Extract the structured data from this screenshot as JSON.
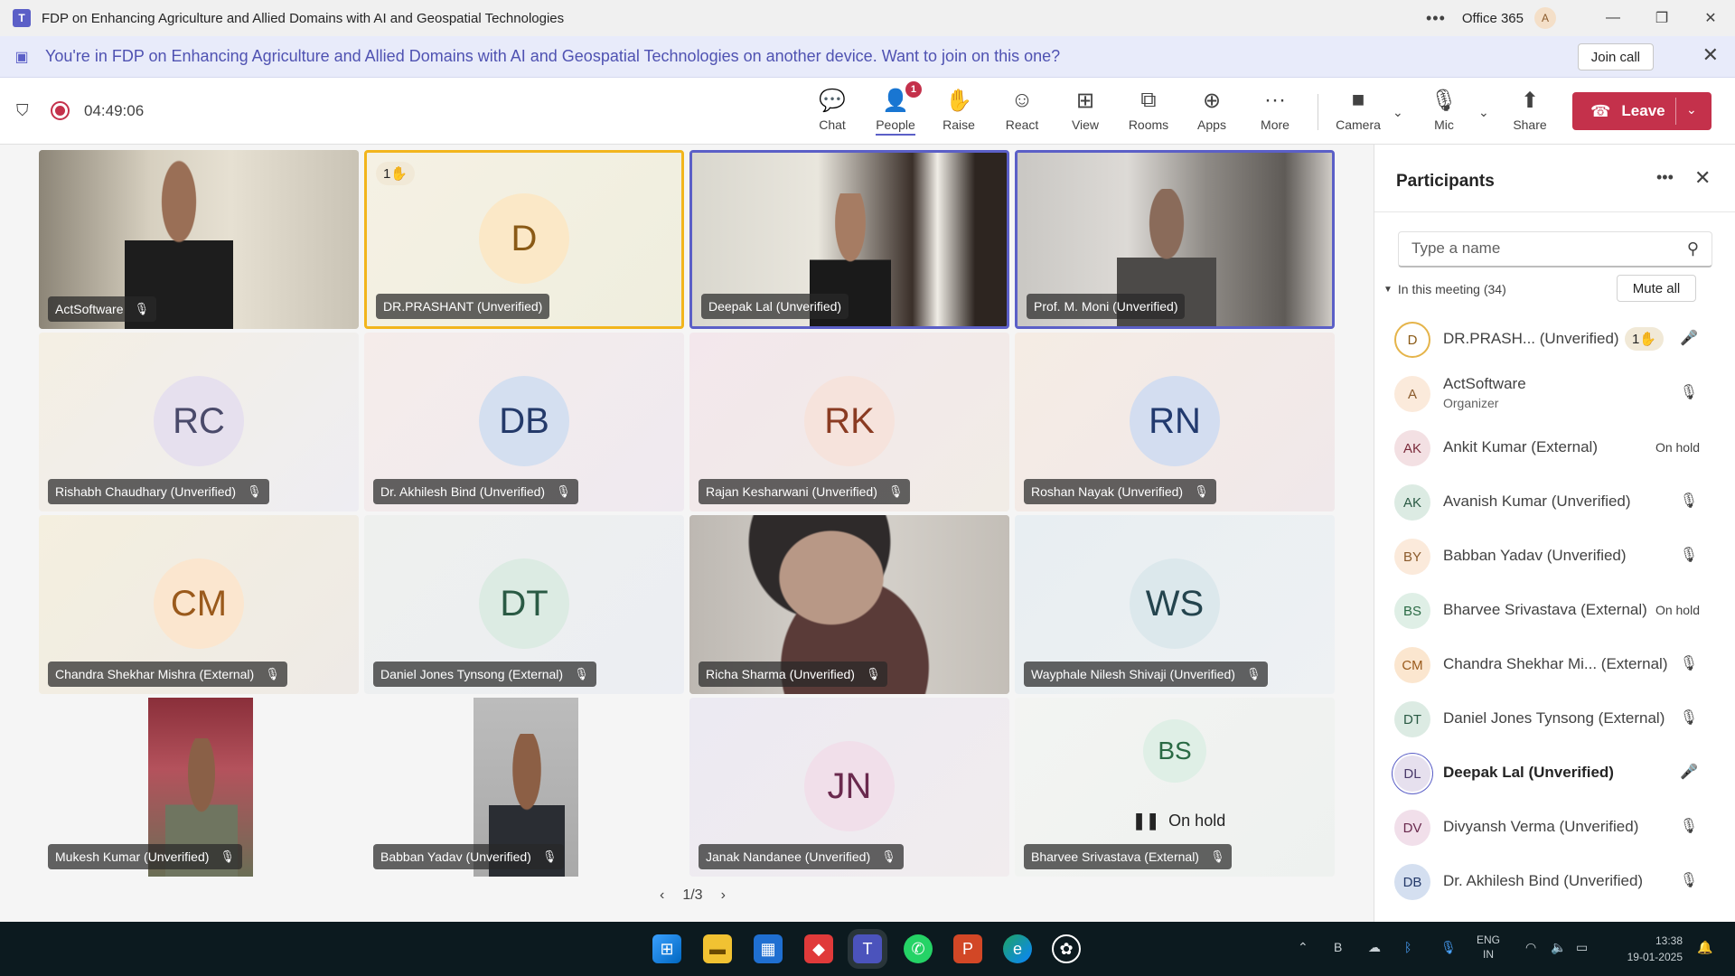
{
  "window": {
    "title": "FDP on Enhancing Agriculture and Allied Domains with AI and Geospatial Technologies",
    "account_label": "Office 365",
    "account_initial": "A"
  },
  "banner": {
    "text": "You're in FDP on Enhancing Agriculture and Allied Domains with AI and Geospatial Technologies on another device. Want to join on this one?",
    "join_label": "Join call"
  },
  "toolbar": {
    "timer": "04:49:06",
    "buttons": {
      "chat": "Chat",
      "people": "People",
      "people_badge": "1",
      "raise": "Raise",
      "react": "React",
      "view": "View",
      "rooms": "Rooms",
      "apps": "Apps",
      "more": "More",
      "camera": "Camera",
      "mic": "Mic",
      "share": "Share",
      "leave": "Leave"
    }
  },
  "tiles": [
    {
      "name": "ActSoftware",
      "type": "video"
    },
    {
      "name": "DR.PRASHANT (Unverified)",
      "initials": "D",
      "hand": "1",
      "type": "avatar"
    },
    {
      "name": "Deepak Lal (Unverified)",
      "type": "video"
    },
    {
      "name": "Prof. M. Moni (Unverified)",
      "type": "video"
    },
    {
      "name": "Rishabh Chaudhary (Unverified)",
      "initials": "RC",
      "type": "avatar"
    },
    {
      "name": "Dr. Akhilesh Bind (Unverified)",
      "initials": "DB",
      "type": "avatar"
    },
    {
      "name": "Rajan Kesharwani (Unverified)",
      "initials": "RK",
      "type": "avatar"
    },
    {
      "name": "Roshan Nayak (Unverified)",
      "initials": "RN",
      "type": "avatar"
    },
    {
      "name": "Chandra Shekhar Mishra (External)",
      "initials": "CM",
      "type": "avatar"
    },
    {
      "name": "Daniel Jones Tynsong (External)",
      "initials": "DT",
      "type": "avatar"
    },
    {
      "name": "Richa Sharma (Unverified)",
      "type": "video"
    },
    {
      "name": "Wayphale Nilesh Shivaji (Unverified)",
      "initials": "WS",
      "type": "avatar"
    },
    {
      "name": "Mukesh Kumar (Unverified)",
      "type": "video"
    },
    {
      "name": "Babban Yadav (Unverified)",
      "type": "video"
    },
    {
      "name": "Janak Nandanee (Unverified)",
      "initials": "JN",
      "type": "avatar"
    },
    {
      "name": "Bharvee Srivastava (External)",
      "initials": "BS",
      "status": "On hold",
      "type": "avatar"
    }
  ],
  "pager": "1/3",
  "participants": {
    "title": "Participants",
    "search_placeholder": "Type a name",
    "section_label": "In this meeting (34)",
    "mute_all": "Mute all",
    "items": [
      {
        "initials": "D",
        "name": "DR.PRASH... (Unverified)",
        "hand": "1",
        "mic": "on"
      },
      {
        "initials": "A",
        "name": "ActSoftware",
        "sub": "Organizer",
        "mic": "muted"
      },
      {
        "initials": "AK",
        "name": "Ankit Kumar (External)",
        "status": "On hold"
      },
      {
        "initials": "AK",
        "name": "Avanish Kumar (Unverified)",
        "mic": "muted"
      },
      {
        "initials": "BY",
        "name": "Babban Yadav (Unverified)",
        "mic": "muted"
      },
      {
        "initials": "BS",
        "name": "Bharvee Srivastava (External)",
        "status": "On hold"
      },
      {
        "initials": "CM",
        "name": "Chandra Shekhar Mi... (External)",
        "mic": "muted"
      },
      {
        "initials": "DT",
        "name": "Daniel Jones Tynsong (External)",
        "mic": "muted"
      },
      {
        "initials": "DL",
        "name": "Deepak Lal (Unverified)",
        "mic": "on"
      },
      {
        "initials": "DV",
        "name": "Divyansh Verma (Unverified)",
        "mic": "muted"
      },
      {
        "initials": "DB",
        "name": "Dr. Akhilesh Bind (Unverified)",
        "mic": "muted"
      }
    ]
  },
  "taskbar": {
    "lang_top": "ENG",
    "lang_bottom": "IN",
    "time": "13:38",
    "date": "19-01-2025"
  }
}
